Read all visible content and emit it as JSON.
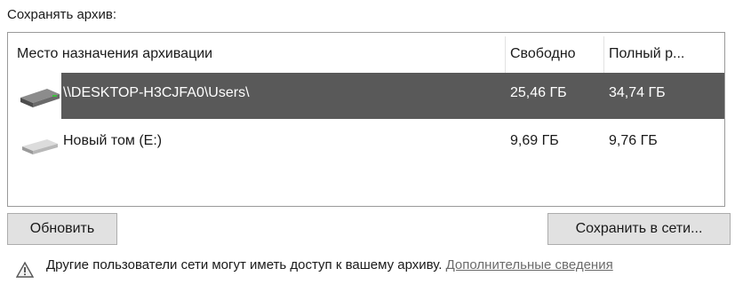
{
  "group_label": "Сохранять архив:",
  "columns": {
    "destination": "Место назначения архивации",
    "free": "Свободно",
    "total": "Полный р..."
  },
  "rows": [
    {
      "name": "\\\\DESKTOP-H3CJFA0\\Users\\",
      "free": "25,46 ГБ",
      "total": "34,74 ГБ",
      "icon": "network-drive-icon",
      "selected": true
    },
    {
      "name": "Новый том (E:)",
      "free": "9,69 ГБ",
      "total": "9,76 ГБ",
      "icon": "drive-icon",
      "selected": false
    }
  ],
  "buttons": {
    "refresh": "Обновить",
    "save_network": "Сохранить в сети..."
  },
  "info": {
    "icon": "warning-icon",
    "text": "Другие пользователи сети могут иметь доступ к вашему архиву. ",
    "link": "Дополнительные сведения"
  },
  "colors": {
    "selection": "#595959",
    "button_bg": "#e1e1e1",
    "link": "#6b6b6b"
  }
}
